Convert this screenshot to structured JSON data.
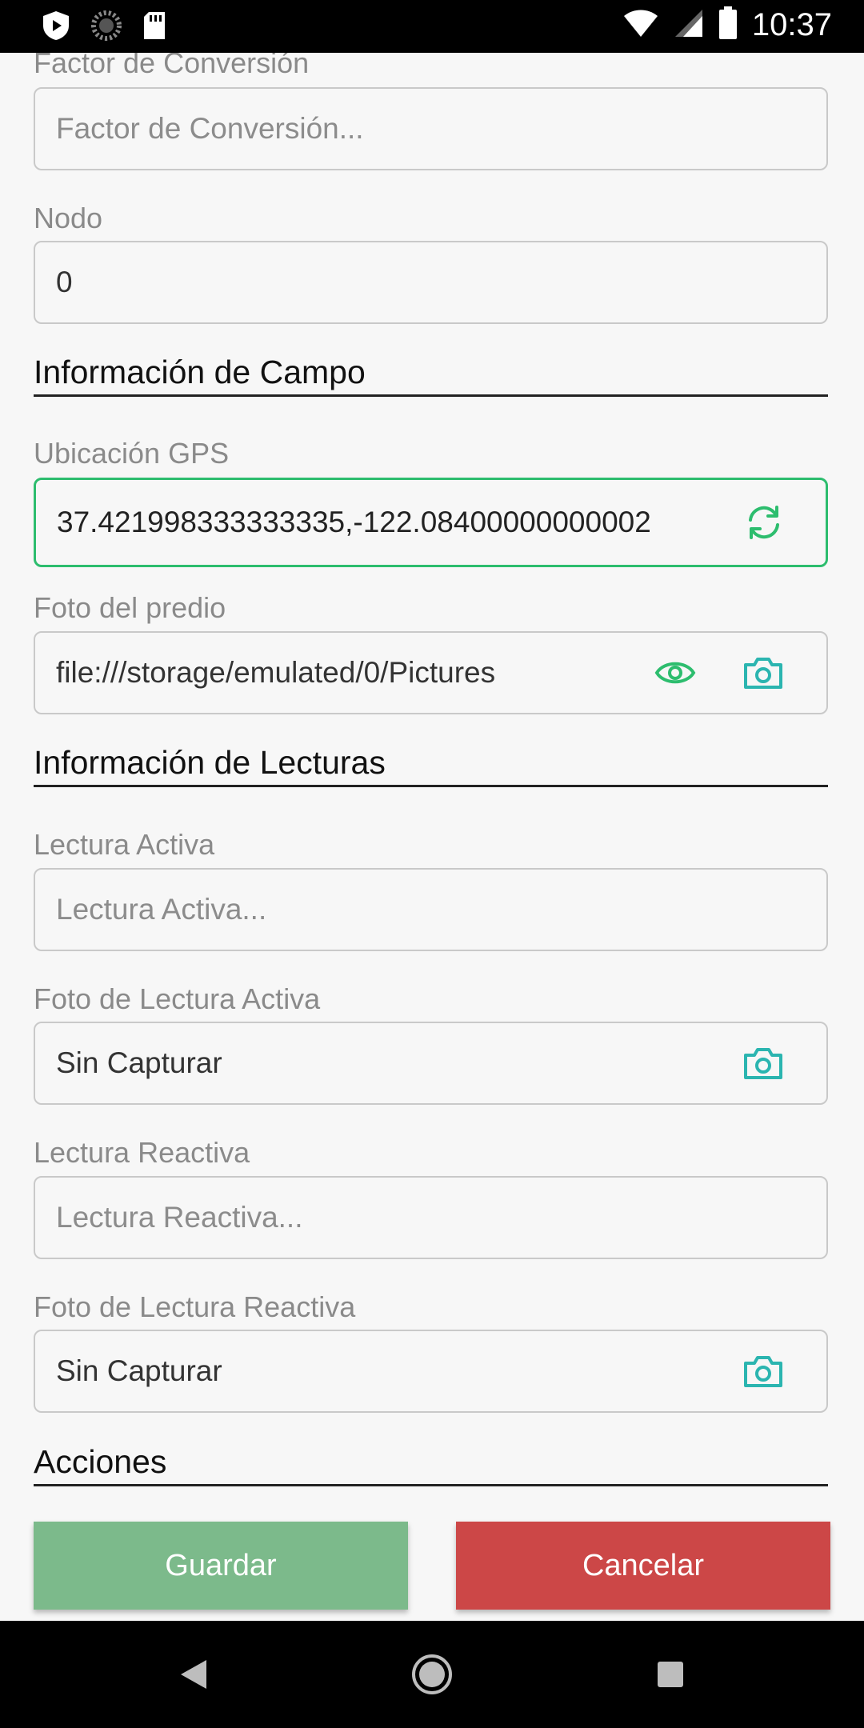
{
  "status_bar": {
    "time": "10:37",
    "icons": [
      "shield-play-icon",
      "loading-icon",
      "sd-card-icon",
      "wifi-icon",
      "signal-icon",
      "battery-icon"
    ]
  },
  "form": {
    "factor_label": "Factor de Conversión",
    "factor_placeholder": "Factor de Conversión...",
    "nodo_label": "Nodo",
    "nodo_value": "0",
    "section_campo": "Información de Campo",
    "gps_label": "Ubicación GPS",
    "gps_value": "37.421998333333335,-122.08400000000002",
    "foto_predio_label": "Foto del predio",
    "foto_predio_value": "file:///storage/emulated/0/Pictures",
    "section_lecturas": "Información de Lecturas",
    "lectura_activa_label": "Lectura Activa",
    "lectura_activa_placeholder": "Lectura Activa...",
    "foto_activa_label": "Foto de Lectura Activa",
    "foto_activa_value": "Sin Capturar",
    "lectura_reactiva_label": "Lectura Reactiva",
    "lectura_reactiva_placeholder": "Lectura Reactiva...",
    "foto_reactiva_label": "Foto de Lectura Reactiva",
    "foto_reactiva_value": "Sin Capturar",
    "section_acciones": "Acciones"
  },
  "actions": {
    "save_label": "Guardar",
    "cancel_label": "Cancelar"
  },
  "colors": {
    "green_accent": "#2dbd6e",
    "teal_icon": "#2bb5b0",
    "save_button": "#7cba8b",
    "cancel_button": "#cc4747"
  }
}
